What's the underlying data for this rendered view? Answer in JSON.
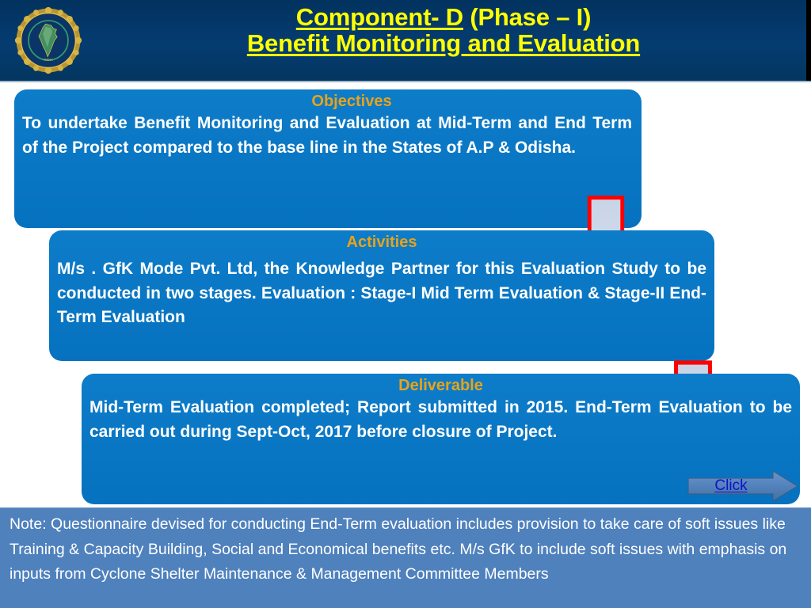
{
  "header": {
    "logo_name": "ndma-emblem",
    "logo_text_outer": "NATIONAL DISASTER MANAGEMENT AUTHORITY",
    "logo_text_inner": "INDIA",
    "title_line1_underlined": "Component- D",
    "title_line1_plain": "  (Phase – I)",
    "title_line2": "Benefit Monitoring and Evaluation",
    "background_color": "#05386b",
    "title_color": "#ffff00"
  },
  "boxes": [
    {
      "id": "objectives",
      "title": "Objectives",
      "body": "To undertake  Benefit Monitoring and  Evaluation at  Mid-Term     and  End  Term  of  the  Project compared to the base line in the States  of  A.P  &  Odisha.",
      "fill_color": "#0a76c6",
      "title_color": "#e8a31a"
    },
    {
      "id": "activities",
      "title": "Activities",
      "body": "M/s .  GfK  Mode  Pvt. Ltd,  the Knowledge  Partner for this Evaluation Study     to  be conducted  in two stages.  Evaluation :  Stage-I   Mid Term Evaluation & Stage-II  End-Term Evaluation",
      "fill_color": "#0a76c6",
      "title_color": "#e8a31a"
    },
    {
      "id": "deliverable",
      "title": "Deliverable",
      "body": "Mid-Term  Evaluation  completed;  Report  submitted  in 2015.  End-Term  Evaluation  to  be   carried out   during Sept-Oct, 2017 before closure of  Project.",
      "fill_color": "#0a76c6",
      "title_color": "#e8a31a"
    }
  ],
  "arrows": {
    "fill_color": "#c3d0e4",
    "stroke_color": "#ff0000",
    "count": 2
  },
  "click_button": {
    "label": "Click",
    "link_color": "#1111cc",
    "arrow_fill": "#4f7cb8"
  },
  "note": {
    "text": "Note: Questionnaire devised for conducting End-Term evaluation includes provision to take care of soft issues like Training & Capacity Building, Social and Economical benefits etc. M/s GfK to include soft issues with emphasis on inputs from Cyclone Shelter Maintenance & Management Committee Members",
    "background_color": "#4f81bd",
    "text_color": "#ffffff"
  }
}
